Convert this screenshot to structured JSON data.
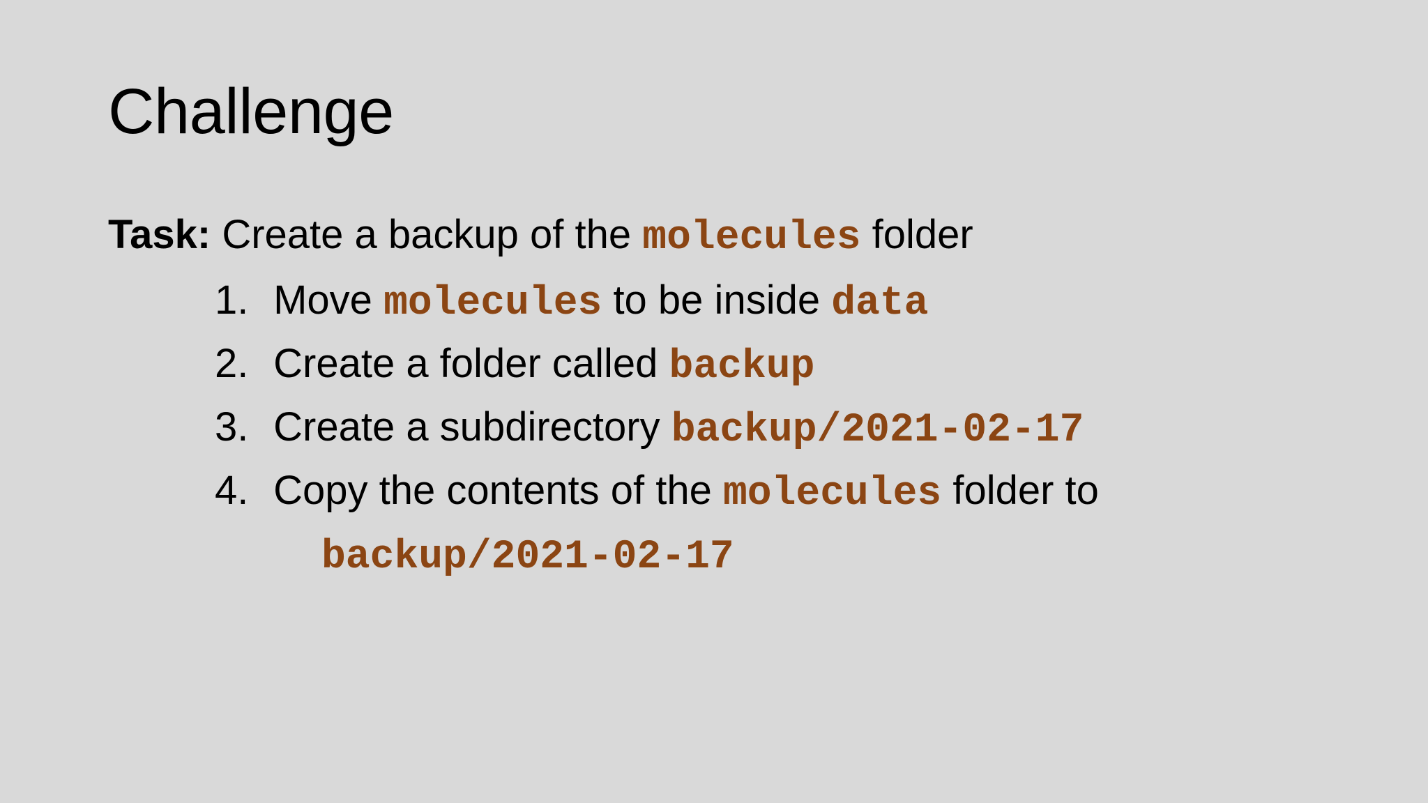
{
  "slide": {
    "title": "Challenge",
    "task": {
      "label": "Task:",
      "text_before": " Create a backup of the ",
      "code": "molecules",
      "text_after": " folder"
    },
    "steps": [
      {
        "number": "1.",
        "text1": " Move ",
        "code1": "molecules",
        "text2": " to be inside ",
        "code2": "data"
      },
      {
        "number": "2.",
        "text1": " Create a folder called ",
        "code1": "backup"
      },
      {
        "number": "3.",
        "text1": " Create a subdirectory ",
        "code1": "backup/2021-02-17"
      },
      {
        "number": "4.",
        "text1": " Copy the contents of the ",
        "code1": "molecules",
        "text2": " folder to",
        "code2": "backup/2021-02-17"
      }
    ]
  },
  "colors": {
    "background": "#d9d9d9",
    "text": "#000000",
    "code": "#8b4513"
  }
}
